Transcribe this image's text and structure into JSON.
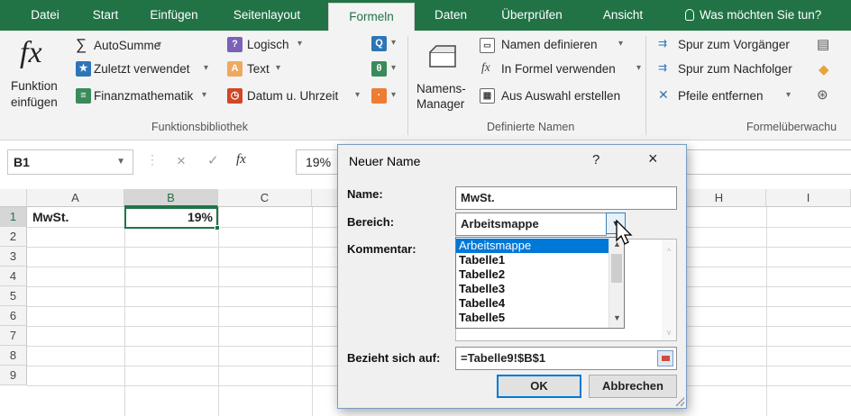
{
  "tabs": {
    "datei": "Datei",
    "start": "Start",
    "einfuegen": "Einfügen",
    "seitenlayout": "Seitenlayout",
    "formeln": "Formeln",
    "daten": "Daten",
    "ueberpruefen": "Überprüfen",
    "ansicht": "Ansicht",
    "tell_me": "Was möchten Sie tun?"
  },
  "ribbon": {
    "funktion_line1": "Funktion",
    "funktion_line2": "einfügen",
    "autosumme": "AutoSumme",
    "zuletzt": "Zuletzt verwendet",
    "finanz": "Finanzmathematik",
    "logisch": "Logisch",
    "text": "Text",
    "datum": "Datum u. Uhrzeit",
    "group_funktionsbibliothek": "Funktionsbibliothek",
    "namens_line1": "Namens-",
    "namens_line2": "Manager",
    "namen_definieren": "Namen definieren",
    "in_formel": "In Formel verwenden",
    "aus_auswahl": "Aus Auswahl erstellen",
    "group_definierte_namen": "Definierte Namen",
    "spur_vorgaenger": "Spur zum Vorgänger",
    "spur_nachfolger": "Spur zum Nachfolger",
    "pfeile_entfernen": "Pfeile entfernen",
    "group_formelueberwachung": "Formelüberwachu"
  },
  "formula_bar": {
    "name_box": "B1",
    "cancel_symbol": "×",
    "enter_symbol": "✓",
    "fx_symbol": "fx",
    "value": "19%"
  },
  "grid": {
    "columns": [
      "A",
      "B",
      "C",
      "H",
      "I"
    ],
    "rows": [
      "1",
      "2",
      "3",
      "4",
      "5",
      "6",
      "7",
      "8",
      "9"
    ],
    "cells": {
      "A1": "MwSt.",
      "B1": "19%"
    }
  },
  "dialog": {
    "title": "Neuer Name",
    "help": "?",
    "close": "×",
    "name_label": "Name:",
    "name_value": "MwSt.",
    "bereich_label": "Bereich:",
    "bereich_value": "Arbeitsmappe",
    "kommentar_label": "Kommentar:",
    "dropdown_options": [
      "Arbeitsmappe",
      "Tabelle1",
      "Tabelle2",
      "Tabelle3",
      "Tabelle4",
      "Tabelle5"
    ],
    "bezieht_label": "Bezieht sich auf:",
    "bezieht_value": "=Tabelle9!$B$1",
    "ok": "OK",
    "cancel": "Abbrechen"
  }
}
